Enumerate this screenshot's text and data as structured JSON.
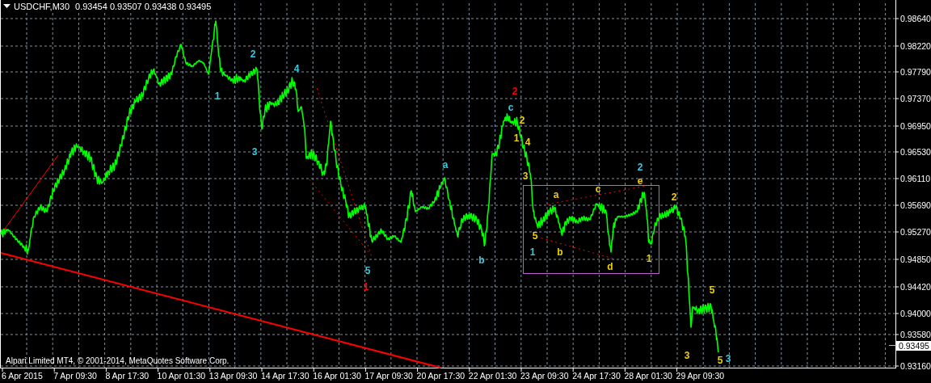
{
  "header": {
    "symbol": "USDCHF,M30",
    "ohlc": "0.93454 0.93507 0.93438 0.93495"
  },
  "price_axis": [
    "0.98640",
    "0.98220",
    "0.97790",
    "0.97370",
    "0.96950",
    "0.96530",
    "0.96110",
    "0.95690",
    "0.95270",
    "0.94850",
    "0.94420",
    "0.94000",
    "0.93580",
    "0.93160"
  ],
  "current_price": "0.93495",
  "time_axis": [
    "6 Apr 2015",
    "7 Apr 09:30",
    "8 Apr 17:30",
    "10 Apr 01:30",
    "13 Apr 09:30",
    "14 Apr 17:30",
    "16 Apr 01:30",
    "17 Apr 09:30",
    "20 Apr 17:30",
    "22 Apr 01:30",
    "23 Apr 09:30",
    "24 Apr 17:30",
    "28 Apr 01:30",
    "29 Apr 09:30"
  ],
  "wave_labels": [
    {
      "text": "1",
      "color": "#3cc8e0"
    },
    {
      "text": "2",
      "color": "#3cc8e0"
    },
    {
      "text": "3",
      "color": "#3cc8e0"
    },
    {
      "text": "4",
      "color": "#3cc8e0"
    },
    {
      "text": "5",
      "color": "#3cc8e0"
    },
    {
      "text": "1",
      "color": "#ff0000"
    },
    {
      "text": "a",
      "color": "#3cc8e0"
    },
    {
      "text": "b",
      "color": "#3cc8e0"
    },
    {
      "text": "2",
      "color": "#ff0000"
    },
    {
      "text": "c",
      "color": "#3cc8e0"
    },
    {
      "text": "2",
      "color": "#f0d000"
    },
    {
      "text": "1",
      "color": "#f0d000"
    },
    {
      "text": "4",
      "color": "#f0d000"
    },
    {
      "text": "3",
      "color": "#f0d000"
    },
    {
      "text": "5",
      "color": "#f0d000"
    },
    {
      "text": "1",
      "color": "#3cc8e0"
    },
    {
      "text": "a",
      "color": "#f0d000"
    },
    {
      "text": "b",
      "color": "#f0d000"
    },
    {
      "text": "c",
      "color": "#f0d000"
    },
    {
      "text": "d",
      "color": "#f0d000"
    },
    {
      "text": "2",
      "color": "#3cc8e0"
    },
    {
      "text": "e",
      "color": "#f0d000"
    },
    {
      "text": "1",
      "color": "#f0d000"
    },
    {
      "text": "2",
      "color": "#f0d000"
    },
    {
      "text": "5",
      "color": "#f0d000"
    },
    {
      "text": "3",
      "color": "#f0d000"
    },
    {
      "text": "5",
      "color": "#f0d000"
    },
    {
      "text": "3",
      "color": "#3cc8e0"
    }
  ],
  "copyright": "Alpari Limited MT4, © 2001-2014, MetaQuotes Software Corp."
}
